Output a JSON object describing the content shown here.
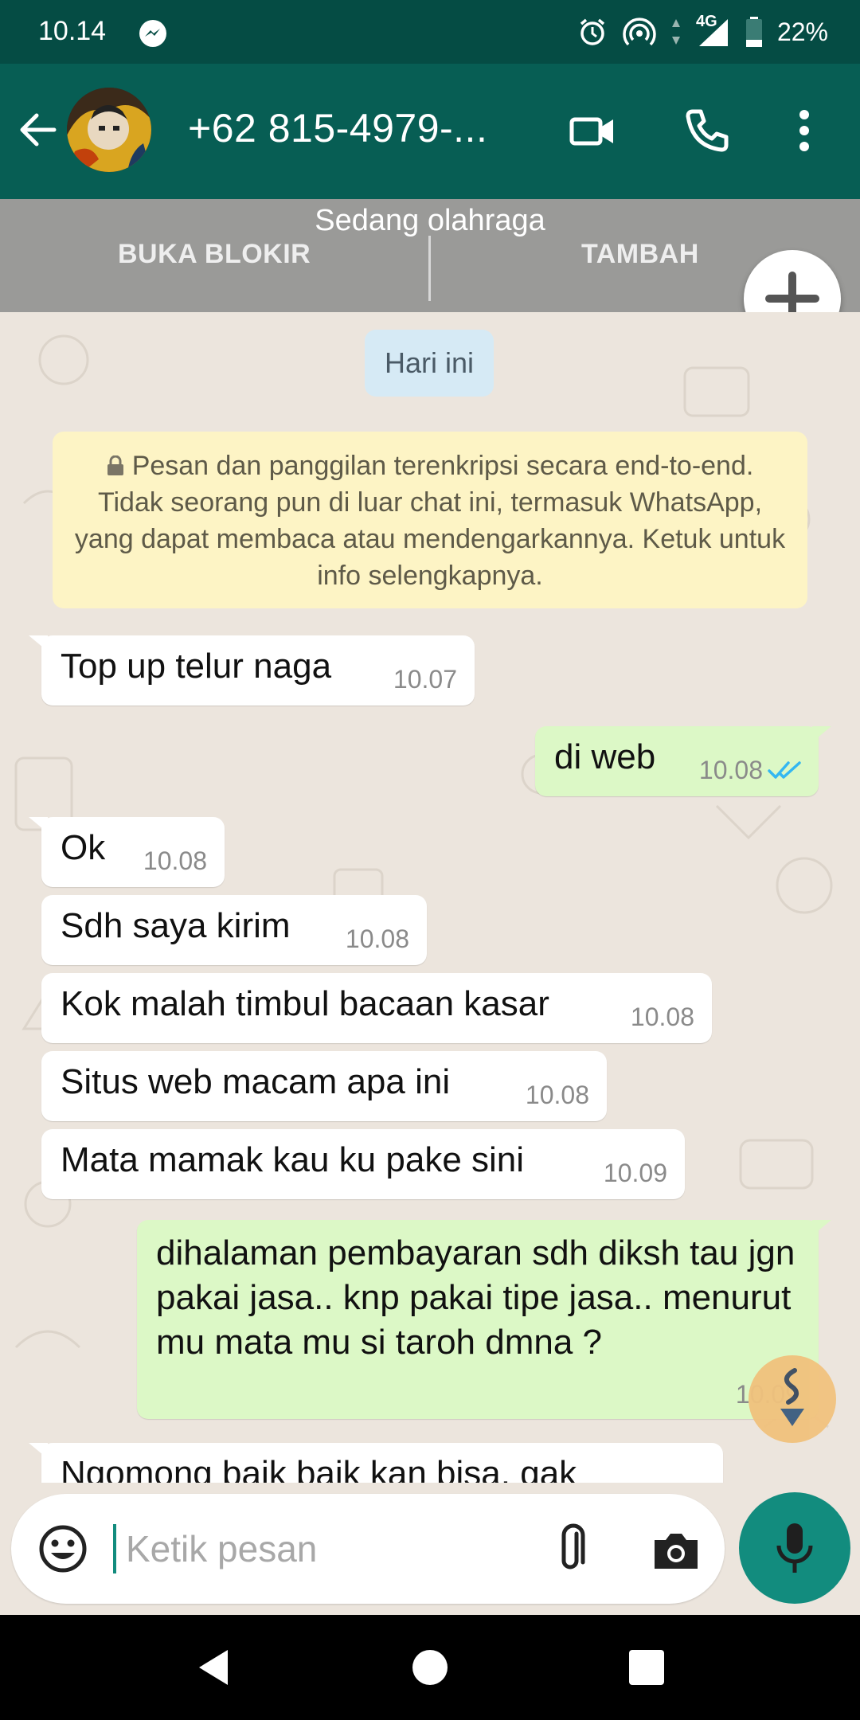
{
  "status_bar": {
    "time": "10.14",
    "network": "4G",
    "battery": "22%"
  },
  "header": {
    "contact": "+62 815-4979-...",
    "icons": [
      "back-arrow-icon",
      "video-call-icon",
      "voice-call-icon",
      "more-vert-icon"
    ]
  },
  "banner": {
    "status": "Sedang olahraga",
    "unblock_label": "BUKA BLOKIR",
    "add_label": "TAMBAH"
  },
  "chat": {
    "date_chip": "Hari ini",
    "encryption_notice": "Pesan dan panggilan terenkripsi secara end-to-end. Tidak seorang pun di luar chat ini, termasuk WhatsApp, yang dapat membaca atau mendengarkannya. Ketuk untuk info selengkapnya.",
    "messages": [
      {
        "direction": "in",
        "text": "Top up telur naga",
        "time": "10.07"
      },
      {
        "direction": "out",
        "text": "di web",
        "time": "10.08",
        "read": true
      },
      {
        "direction": "in",
        "text": "Ok",
        "time": "10.08"
      },
      {
        "direction": "in",
        "text": "Sdh saya kirim",
        "time": "10.08"
      },
      {
        "direction": "in",
        "text": "Kok malah timbul bacaan kasar",
        "time": "10.08"
      },
      {
        "direction": "in",
        "text": "Situs web macam apa ini",
        "time": "10.08"
      },
      {
        "direction": "in",
        "text": "Mata mamak kau ku pake sini",
        "time": "10.09"
      },
      {
        "direction": "out",
        "text": "dihalaman pembayaran sdh diksh tau jgn pakai jasa.. knp pakai tipe jasa.. menurut mu mata mu si taroh dmna ?",
        "time": "10.09"
      },
      {
        "direction": "in",
        "text": "Ngomong baik baik kan bisa, gak",
        "time": ""
      }
    ]
  },
  "input": {
    "placeholder": "Ketik pesan"
  },
  "colors": {
    "header": "#075e54",
    "status_bar": "#054c44",
    "outgoing_bubble": "#dcf8c6",
    "incoming_bubble": "#ffffff",
    "accent": "#128c7e",
    "read_ticks": "#34b7f1"
  }
}
